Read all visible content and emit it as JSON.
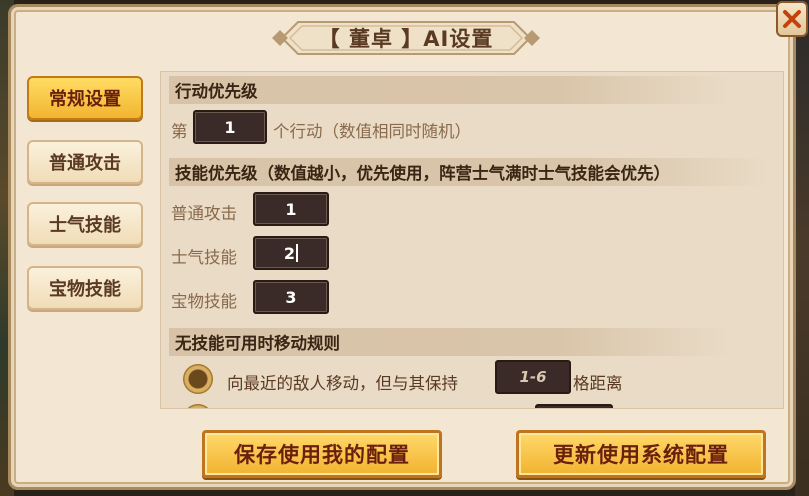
{
  "window": {
    "title": "【 董卓 】AI设置"
  },
  "sidebar": {
    "items": [
      {
        "label": "常规设置",
        "active": true
      },
      {
        "label": "普通攻击",
        "active": false
      },
      {
        "label": "士气技能",
        "active": false
      },
      {
        "label": "宝物技能",
        "active": false
      }
    ]
  },
  "action_priority": {
    "header": "行动优先级",
    "prefix": "第",
    "value": "1",
    "suffix": "个行动（数值相同时随机）"
  },
  "skill_priority": {
    "header": "技能优先级（数值越小，优先使用，阵营士气满时士气技能会优先）",
    "rows": [
      {
        "label": "普通攻击",
        "value": "1"
      },
      {
        "label": "士气技能",
        "value": "2"
      },
      {
        "label": "宝物技能",
        "value": "3"
      }
    ]
  },
  "move_rules": {
    "header": "无技能可用时移动规则",
    "options": [
      {
        "text_before": "向最近的敌人移动，但与其保持",
        "range": "1-6",
        "text_after": "格距离"
      }
    ]
  },
  "footer": {
    "save_label": "保存使用我的配置",
    "system_label": "更新使用系统配置"
  },
  "colors": {
    "accent_gold": "#f2b531",
    "panel_bg": "#e9dbc6",
    "field_bg": "#3b2b28",
    "title_text": "#5a3a22"
  },
  "icons": {
    "close": "close-icon"
  }
}
